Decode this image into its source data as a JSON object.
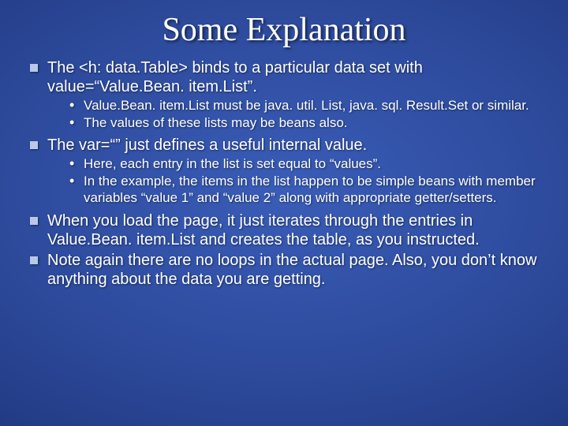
{
  "title": "Some Explanation",
  "bullets": [
    {
      "text": "The <h: data.Table> binds to a particular data set with value=“Value.Bean. item.List”.",
      "sub": [
        "Value.Bean. item.List must be java. util. List, java. sql. Result.Set or similar.",
        "The values of these lists may be beans also."
      ]
    },
    {
      "text": "The var=“” just defines a useful internal value.",
      "sub": [
        "Here, each entry in the list is set equal to “values”.",
        "In the example, the items in the list happen to be simple beans with member variables “value 1” and “value 2” along with appropriate getter/setters."
      ]
    },
    {
      "text": "When you load the page, it just iterates through the entries in Value.Bean. item.List and creates the table, as you instructed.",
      "sub": []
    },
    {
      "text": "Note again there are no loops in the actual page. Also, you don’t know anything about the data you are getting.",
      "sub": []
    }
  ]
}
